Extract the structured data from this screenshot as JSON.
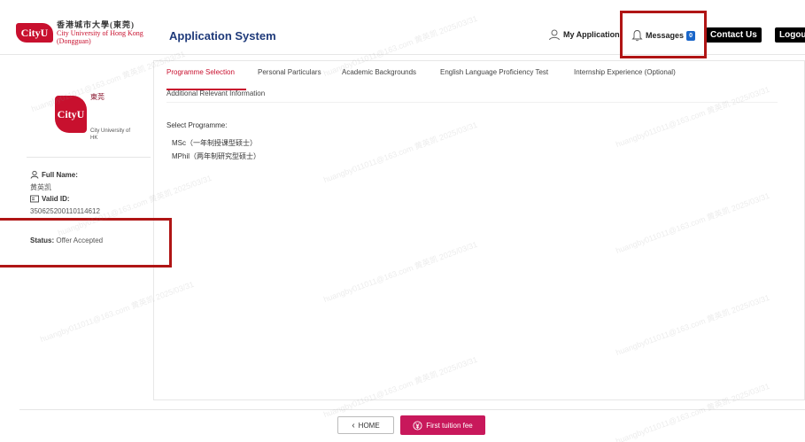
{
  "header": {
    "logo": {
      "mark": "CityU",
      "cn_name": "香港城市大學(東莞)",
      "en_name": "City University of Hong Kong",
      "en_sub": "(Dongguan)"
    },
    "app_title": "Application System",
    "nav": {
      "my_application": "My Application",
      "messages": "Messages",
      "messages_count": "0",
      "contact_us": "Contact Us",
      "logout": "Logout"
    }
  },
  "profile": {
    "logo_mark": "CityU",
    "logo_cn": "東莞",
    "logo_sub": "City University of HK",
    "full_name_label": "Full Name:",
    "full_name_value": "黄英凯",
    "valid_id_label": "Valid ID:",
    "valid_id_value": "350625200110114612",
    "status_label": "Status:",
    "status_value": "Offer Accepted"
  },
  "tabs": [
    {
      "label": "Programme Selection",
      "active": true
    },
    {
      "label": "Personal Particulars",
      "active": false
    },
    {
      "label": "Academic Backgrounds",
      "active": false
    },
    {
      "label": "English Language Proficiency Test",
      "active": false
    },
    {
      "label": "Internship Experience (Optional)",
      "active": false
    },
    {
      "label": "Additional Relevant Information",
      "active": false
    }
  ],
  "content": {
    "select_label": "Select Programme:",
    "programmes": [
      "MSc（一年制授课型硕士）",
      "MPhil（两年制研究型硕士）"
    ]
  },
  "footer": {
    "home_label": "HOME",
    "fee_label": "First tuition fee"
  },
  "watermark": "huangby011011@163.com 黄英凯 2025/03/31",
  "colors": {
    "brand_red": "#c8102e",
    "title_blue": "#1f3a7a",
    "badge_blue": "#1a66c9",
    "fee_button": "#c8185b",
    "highlight": "#b01515"
  },
  "icons": {
    "user": "person-icon",
    "bell": "bell-icon",
    "id": "id-card-icon",
    "chevron": "chevron-left-icon",
    "fee": "payment-icon"
  }
}
